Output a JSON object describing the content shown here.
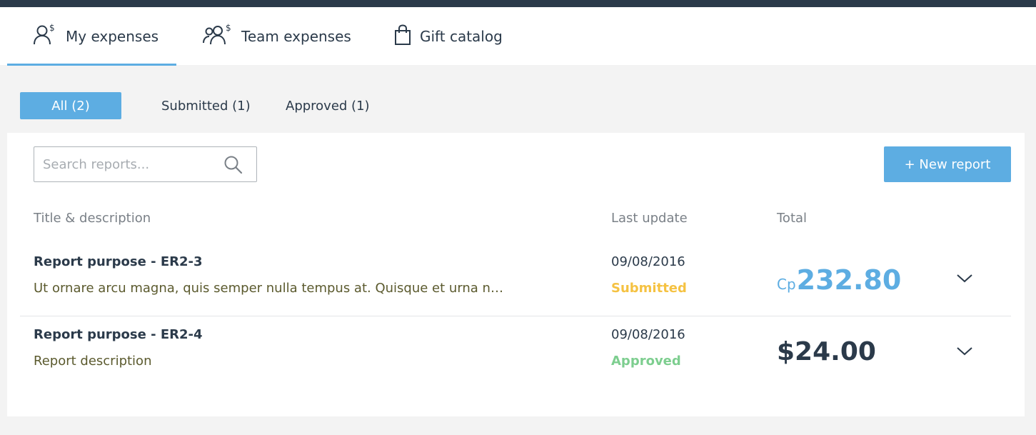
{
  "tabs": [
    {
      "label": "My expenses",
      "icon": "user-dollar-icon",
      "active": true
    },
    {
      "label": "Team expenses",
      "icon": "users-dollar-icon",
      "active": false
    },
    {
      "label": "Gift catalog",
      "icon": "shopping-bag-icon",
      "active": false
    }
  ],
  "filters": [
    {
      "label": "All (2)",
      "active": true
    },
    {
      "label": "Submitted (1)",
      "active": false
    },
    {
      "label": "Approved (1)",
      "active": false
    }
  ],
  "search": {
    "placeholder": "Search reports...",
    "value": ""
  },
  "new_report_label": "+ New report",
  "columns": {
    "title": "Title & description",
    "last_update": "Last update",
    "total": "Total"
  },
  "reports": [
    {
      "title": "Report purpose - ER2-3",
      "description": "Ut ornare arcu magna, quis semper nulla tempus at. Quisque et urna nisi...",
      "date": "09/08/2016",
      "status": "Submitted",
      "currency": "Cp",
      "amount": "232.80"
    },
    {
      "title": "Report purpose - ER2-4",
      "description": "Report description",
      "date": "09/08/2016",
      "status": "Approved",
      "currency": "",
      "amount": "$24.00"
    }
  ],
  "colors": {
    "accent": "#5dade2",
    "topbar": "#2b3a4a",
    "submitted": "#f5c242",
    "approved": "#7dce8f"
  }
}
